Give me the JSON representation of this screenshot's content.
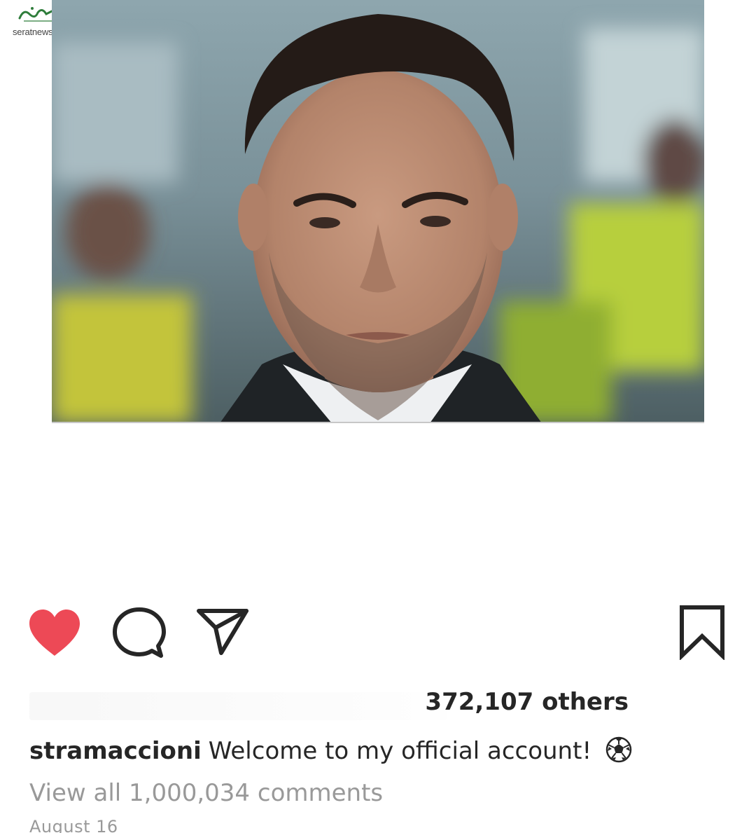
{
  "watermark": {
    "text": "seratnews.ir"
  },
  "post": {
    "image_alt": "portrait photo",
    "username": "stramaccioni",
    "caption_text": "Welcome to my official account!",
    "caption_emoji": "soccer-ball-icon",
    "likes_text": "372,107 others",
    "view_comments": "View all 1,000,034 comments",
    "date": "August 16"
  },
  "actions": {
    "like_icon": "heart-icon",
    "liked": true,
    "like_color": "#ed4956",
    "comment_icon": "comment-icon",
    "share_icon": "paper-plane-icon",
    "save_icon": "bookmark-icon"
  },
  "colors": {
    "text": "#262626",
    "muted": "#999999"
  }
}
